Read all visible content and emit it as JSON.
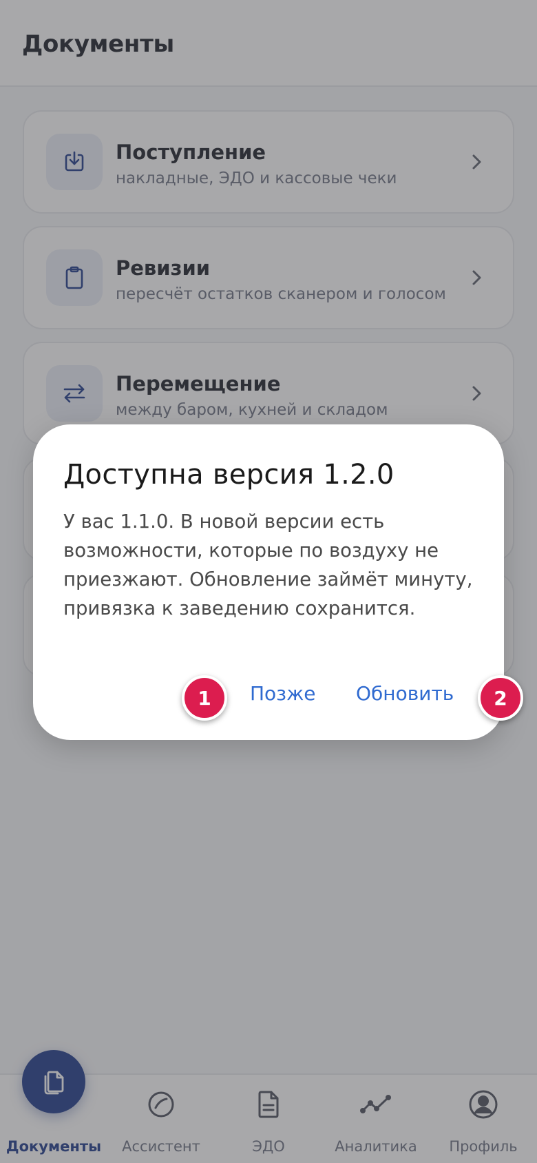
{
  "header": {
    "title": "Документы"
  },
  "cards": [
    {
      "title": "Поступление",
      "subtitle": "накладные, ЭДО и кассовые чеки",
      "icon": "download-icon"
    },
    {
      "title": "Ревизии",
      "subtitle": "пересчёт остатков сканером и голосом",
      "icon": "clipboard-icon"
    },
    {
      "title": "Перемещение",
      "subtitle": "между баром, кухней и складом",
      "icon": "swap-arrows-icon"
    }
  ],
  "dialog": {
    "title": "Доступна версия 1.2.0",
    "body": "У вас 1.1.0. В новой версии есть возможности, которые по воздуху не приезжают. Обновление займёт минуту, привязка к заведению сохранится.",
    "later_label": "Позже",
    "update_label": "Обновить"
  },
  "markers": {
    "first": "1",
    "second": "2"
  },
  "nav": {
    "items": [
      {
        "label": "Документы",
        "icon": "documents-icon",
        "active": true
      },
      {
        "label": "Ассистент",
        "icon": "assistant-icon",
        "active": false
      },
      {
        "label": "ЭДО",
        "icon": "file-icon",
        "active": false
      },
      {
        "label": "Аналитика",
        "icon": "analytics-icon",
        "active": false
      },
      {
        "label": "Профиль",
        "icon": "profile-icon",
        "active": false
      }
    ]
  },
  "colors": {
    "accent": "#1e3a8a",
    "link": "#2f6ad0",
    "marker": "#dc1d4f"
  }
}
